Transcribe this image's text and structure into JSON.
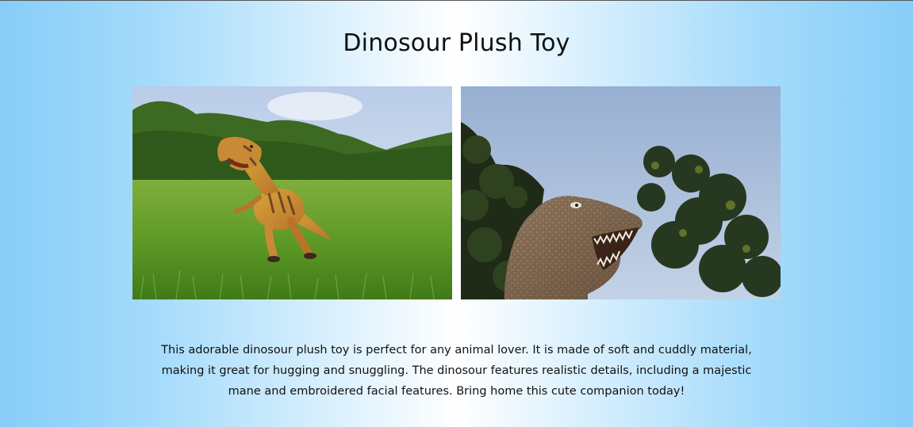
{
  "page": {
    "title": "Dinosour Plush Toy",
    "description": "This adorable dinosour plush toy is perfect for any animal lover. It is made of soft and cuddly material, making it great for hugging and snuggling. The dinosour features realistic details, including a majestic mane and embroidered facial features. Bring home this cute companion today!"
  },
  "colors": {
    "background_edge": "#87cdf8",
    "background_center": "#ffffff",
    "text": "#111111"
  }
}
